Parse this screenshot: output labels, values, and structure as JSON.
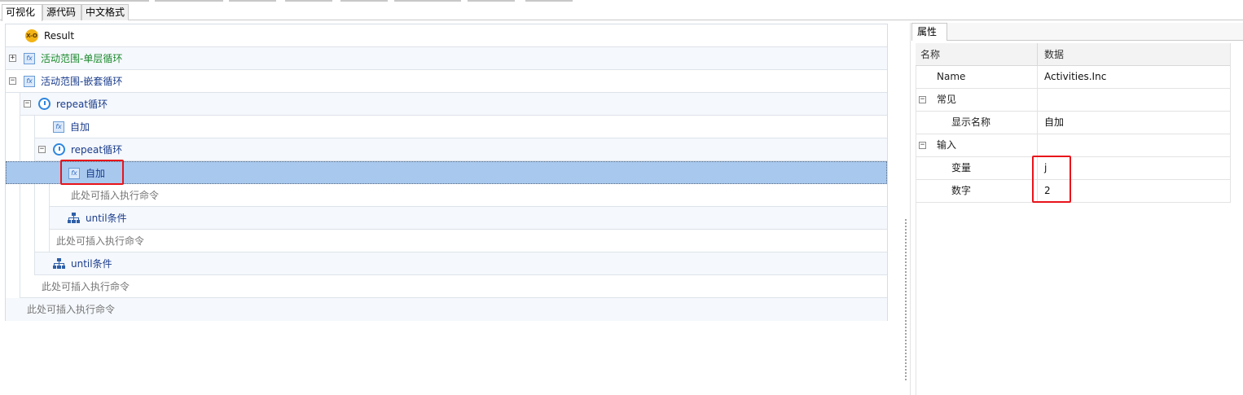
{
  "view_tabs": [
    "可视化",
    "源代码",
    "中文格式"
  ],
  "tree": {
    "result": "Result",
    "result_icon": "x-o-icon",
    "scope_single": "活动范围-单层循环",
    "scope_nested": "活动范围-嵌套循环",
    "repeat_outer": "repeat循环",
    "inc_outer": "自加",
    "repeat_inner": "repeat循环",
    "inc_inner": "自加",
    "placeholder_1": "此处可插入执行命令",
    "until_inner": "until条件",
    "placeholder_2": "此处可插入执行命令",
    "until_outer": "until条件",
    "placeholder_3": "此处可插入执行命令",
    "placeholder_4": "此处可插入执行命令",
    "toggle_plus": "+",
    "toggle_minus": "−",
    "fx_glyph": "fx",
    "xo_glyph": "X-O"
  },
  "properties": {
    "tab": "属性",
    "col_name": "名称",
    "col_data": "数据",
    "name_key": "Name",
    "name_value": "Activities.Inc",
    "group_common": "常见",
    "display_name_key": "显示名称",
    "display_name_value": "自加",
    "group_input": "输入",
    "variable_key": "变量",
    "variable_value": "j",
    "number_key": "数字",
    "number_value": "2"
  },
  "colors": {
    "selection": "#a8c8ee",
    "highlight_box": "#e8141b",
    "scope_single_label": "#1c8a2e",
    "activity_label": "#1a3c8c",
    "placeholder_label": "#777777"
  }
}
